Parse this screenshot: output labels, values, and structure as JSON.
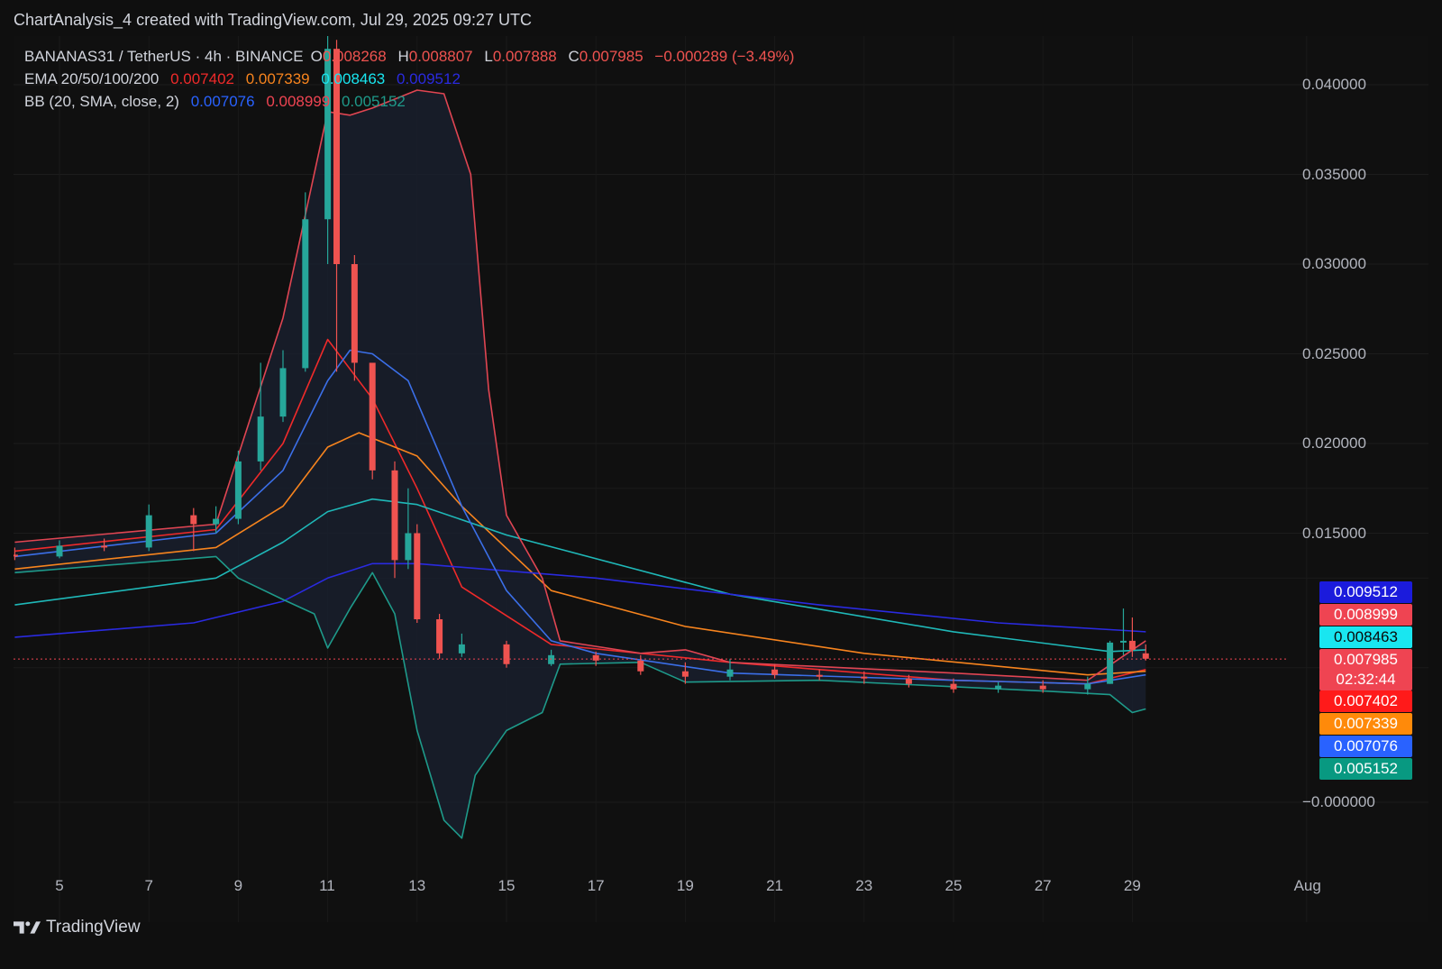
{
  "caption": "ChartAnalysis_4 created with TradingView.com, Jul 29, 2025 09:27 UTC",
  "legend": {
    "symbol": "BANANAS31 / TetherUS · 4h · BINANCE",
    "o_label": "O",
    "o_value": "0.008268",
    "h_label": "H",
    "h_value": "0.008807",
    "l_label": "L",
    "l_value": "0.007888",
    "c_label": "C",
    "c_value": "0.007985",
    "change": "−0.000289 (−3.49%)",
    "ema_label": "EMA 20/50/100/200",
    "ema_values": [
      "0.007402",
      "0.007339",
      "0.008463",
      "0.009512"
    ],
    "bb_label": "BB (20, SMA, close, 2)",
    "bb_values": [
      "0.007076",
      "0.008999",
      "0.005152"
    ]
  },
  "price_tags": [
    {
      "text": "0.009512",
      "color": "#1b1bdc",
      "value": 0.009512
    },
    {
      "text": "0.008999",
      "color": "#ef4452",
      "value": 0.008999
    },
    {
      "text": "0.008463",
      "color": "#19e6f0",
      "value": 0.008463
    },
    {
      "text": "0.007985",
      "color": "#ef4452",
      "value": 0.007985
    },
    {
      "text": "02:32:44",
      "color": "#ef4452",
      "value": null
    },
    {
      "text": "0.007402",
      "color": "#ff1a1a",
      "value": 0.007402
    },
    {
      "text": "0.007339",
      "color": "#ff8a0a",
      "value": 0.007339
    },
    {
      "text": "0.007076",
      "color": "#2962ff",
      "value": 0.007076
    },
    {
      "text": "0.005152",
      "color": "#089981",
      "value": 0.005152
    }
  ],
  "footer": "TradingView",
  "colors": {
    "up": "#26a69a",
    "down": "#ef5350",
    "ema20": "#ef2a2a",
    "ema50": "#f7841e",
    "ema100": "#1fb8b8",
    "ema200": "#2a2ae0",
    "bb_basis": "#3b6fe8",
    "bb_upper": "#e04552",
    "bb_lower": "#1e9a8a",
    "bb_fill": "#1a2030"
  },
  "chart_data": {
    "type": "candlestick",
    "title": "BANANAS31 / TetherUS · 4h · BINANCE",
    "x_ticks": [
      "5",
      "7",
      "9",
      "11",
      "13",
      "15",
      "17",
      "19",
      "21",
      "23",
      "25",
      "27",
      "29",
      "Aug"
    ],
    "y_ticks": [
      "0.040000",
      "0.035000",
      "0.030000",
      "0.025000",
      "0.020000",
      "0.015000",
      "−0.000000"
    ],
    "ylim": [
      -0.0035,
      0.0425
    ],
    "xlim": [
      "2025-07-04",
      "2025-08-03"
    ],
    "current_price": 0.007985,
    "countdown": "02:32:44",
    "candles_ohlc": [
      [
        "2025-07-04",
        0.0138,
        0.0142,
        0.0135,
        0.0137
      ],
      [
        "2025-07-05",
        0.0137,
        0.0146,
        0.0136,
        0.0143
      ],
      [
        "2025-07-06",
        0.0143,
        0.0147,
        0.014,
        0.0142
      ],
      [
        "2025-07-07",
        0.0142,
        0.0166,
        0.014,
        0.016
      ],
      [
        "2025-07-08",
        0.016,
        0.0164,
        0.014,
        0.0155
      ],
      [
        "2025-07-08.5",
        0.0155,
        0.0165,
        0.015,
        0.0158
      ],
      [
        "2025-07-09",
        0.0158,
        0.0196,
        0.0155,
        0.019
      ],
      [
        "2025-07-09.5",
        0.019,
        0.0245,
        0.0185,
        0.0215
      ],
      [
        "2025-07-10",
        0.0215,
        0.0252,
        0.0212,
        0.0242
      ],
      [
        "2025-07-10.5",
        0.0242,
        0.034,
        0.024,
        0.0325
      ],
      [
        "2025-07-11",
        0.0325,
        0.043,
        0.03,
        0.042
      ],
      [
        "2025-07-11.2",
        0.042,
        0.0425,
        0.024,
        0.03
      ],
      [
        "2025-07-11.6",
        0.03,
        0.0305,
        0.0235,
        0.0245
      ],
      [
        "2025-07-12",
        0.0245,
        0.022,
        0.018,
        0.0185
      ],
      [
        "2025-07-12.5",
        0.0185,
        0.019,
        0.0125,
        0.0135
      ],
      [
        "2025-07-12.8",
        0.0135,
        0.0175,
        0.013,
        0.015
      ],
      [
        "2025-07-13",
        0.015,
        0.0155,
        0.01,
        0.0102
      ],
      [
        "2025-07-13.5",
        0.0102,
        0.0105,
        0.008,
        0.0083
      ],
      [
        "2025-07-14",
        0.0083,
        0.0094,
        0.0081,
        0.0088
      ],
      [
        "2025-07-15",
        0.0088,
        0.009,
        0.0075,
        0.0077
      ],
      [
        "2025-07-16",
        0.0077,
        0.0085,
        0.0076,
        0.0082
      ],
      [
        "2025-07-17",
        0.0082,
        0.0084,
        0.0076,
        0.0079
      ],
      [
        "2025-07-18",
        0.0079,
        0.0082,
        0.0071,
        0.0073
      ],
      [
        "2025-07-19",
        0.0073,
        0.0078,
        0.0066,
        0.007
      ],
      [
        "2025-07-20",
        0.007,
        0.008,
        0.0068,
        0.0074
      ],
      [
        "2025-07-21",
        0.0074,
        0.0077,
        0.0069,
        0.0071
      ],
      [
        "2025-07-22",
        0.0071,
        0.0074,
        0.0068,
        0.007
      ],
      [
        "2025-07-23",
        0.007,
        0.0073,
        0.0066,
        0.0069
      ],
      [
        "2025-07-24",
        0.0069,
        0.0071,
        0.0064,
        0.0066
      ],
      [
        "2025-07-25",
        0.0066,
        0.0069,
        0.0061,
        0.0063
      ],
      [
        "2025-07-26",
        0.0063,
        0.0067,
        0.0061,
        0.0065
      ],
      [
        "2025-07-27",
        0.0065,
        0.0068,
        0.0061,
        0.0063
      ],
      [
        "2025-07-28",
        0.0063,
        0.007,
        0.006,
        0.0066
      ],
      [
        "2025-07-28.5",
        0.0066,
        0.009,
        0.0066,
        0.0089
      ],
      [
        "2025-07-28.8",
        0.0089,
        0.0108,
        0.0082,
        0.009
      ],
      [
        "2025-07-29",
        0.009,
        0.0103,
        0.0081,
        0.0085
      ],
      [
        "2025-07-29.3",
        0.0083,
        0.0088,
        0.0079,
        0.008
      ]
    ],
    "series": [
      {
        "name": "EMA 20",
        "color": "#ef2a2a",
        "points": [
          [
            "2025-07-04",
            0.014
          ],
          [
            "2025-07-08.5",
            0.0152
          ],
          [
            "2025-07-10",
            0.02
          ],
          [
            "2025-07-11",
            0.0258
          ],
          [
            "2025-07-12",
            0.0225
          ],
          [
            "2025-07-13",
            0.0175
          ],
          [
            "2025-07-14",
            0.012
          ],
          [
            "2025-07-16",
            0.0088
          ],
          [
            "2025-07-20",
            0.0078
          ],
          [
            "2025-07-25",
            0.0068
          ],
          [
            "2025-07-28",
            0.0066
          ],
          [
            "2025-07-29.3",
            0.0074
          ]
        ]
      },
      {
        "name": "EMA 50",
        "color": "#f7841e",
        "points": [
          [
            "2025-07-04",
            0.013
          ],
          [
            "2025-07-08.5",
            0.0142
          ],
          [
            "2025-07-10",
            0.0165
          ],
          [
            "2025-07-11",
            0.0198
          ],
          [
            "2025-07-11.7",
            0.0206
          ],
          [
            "2025-07-13",
            0.0193
          ],
          [
            "2025-07-14",
            0.0165
          ],
          [
            "2025-07-16",
            0.0118
          ],
          [
            "2025-07-19",
            0.0098
          ],
          [
            "2025-07-23",
            0.0083
          ],
          [
            "2025-07-28",
            0.0071
          ],
          [
            "2025-07-29.3",
            0.0073
          ]
        ]
      },
      {
        "name": "EMA 100",
        "color": "#1fb8b8",
        "points": [
          [
            "2025-07-04",
            0.011
          ],
          [
            "2025-07-08.5",
            0.0125
          ],
          [
            "2025-07-10",
            0.0145
          ],
          [
            "2025-07-11",
            0.0162
          ],
          [
            "2025-07-12",
            0.0169
          ],
          [
            "2025-07-13",
            0.0166
          ],
          [
            "2025-07-15",
            0.0149
          ],
          [
            "2025-07-20",
            0.0116
          ],
          [
            "2025-07-25",
            0.0095
          ],
          [
            "2025-07-28.5",
            0.0084
          ],
          [
            "2025-07-29.3",
            0.0085
          ]
        ]
      },
      {
        "name": "EMA 200",
        "color": "#2a2ae0",
        "points": [
          [
            "2025-07-04",
            0.0092
          ],
          [
            "2025-07-08",
            0.01
          ],
          [
            "2025-07-10",
            0.0112
          ],
          [
            "2025-07-11",
            0.0125
          ],
          [
            "2025-07-12",
            0.0133
          ],
          [
            "2025-07-13",
            0.0133
          ],
          [
            "2025-07-17",
            0.0125
          ],
          [
            "2025-07-22",
            0.011
          ],
          [
            "2025-07-26",
            0.01
          ],
          [
            "2025-07-29.3",
            0.0095
          ]
        ]
      },
      {
        "name": "BB basis",
        "color": "#3b6fe8",
        "points": [
          [
            "2025-07-04",
            0.0137
          ],
          [
            "2025-07-08.5",
            0.015
          ],
          [
            "2025-07-10",
            0.0185
          ],
          [
            "2025-07-11",
            0.0235
          ],
          [
            "2025-07-11.5",
            0.0252
          ],
          [
            "2025-07-12",
            0.025
          ],
          [
            "2025-07-12.8",
            0.0235
          ],
          [
            "2025-07-14",
            0.0165
          ],
          [
            "2025-07-15",
            0.0118
          ],
          [
            "2025-07-16",
            0.009
          ],
          [
            "2025-07-17",
            0.0083
          ],
          [
            "2025-07-20",
            0.0072
          ],
          [
            "2025-07-25",
            0.0068
          ],
          [
            "2025-07-28",
            0.0066
          ],
          [
            "2025-07-29.3",
            0.0071
          ]
        ]
      },
      {
        "name": "BB upper",
        "color": "#e04552",
        "points": [
          [
            "2025-07-04",
            0.0145
          ],
          [
            "2025-07-08.5",
            0.0155
          ],
          [
            "2025-07-10",
            0.027
          ],
          [
            "2025-07-11",
            0.0385
          ],
          [
            "2025-07-11.5",
            0.0383
          ],
          [
            "2025-07-12",
            0.0387
          ],
          [
            "2025-07-13",
            0.0397
          ],
          [
            "2025-07-13.6",
            0.0395
          ],
          [
            "2025-07-14.2",
            0.035
          ],
          [
            "2025-07-14.6",
            0.023
          ],
          [
            "2025-07-15",
            0.016
          ],
          [
            "2025-07-15.8",
            0.0125
          ],
          [
            "2025-07-16.2",
            0.009
          ],
          [
            "2025-07-18",
            0.0083
          ],
          [
            "2025-07-19",
            0.0085
          ],
          [
            "2025-07-20",
            0.0078
          ],
          [
            "2025-07-25",
            0.0072
          ],
          [
            "2025-07-28",
            0.0068
          ],
          [
            "2025-07-29.3",
            0.009
          ]
        ]
      },
      {
        "name": "BB lower",
        "color": "#1e9a8a",
        "points": [
          [
            "2025-07-04",
            0.0128
          ],
          [
            "2025-07-08.5",
            0.0137
          ],
          [
            "2025-07-09",
            0.0125
          ],
          [
            "2025-07-10",
            0.0113
          ],
          [
            "2025-07-10.7",
            0.0105
          ],
          [
            "2025-07-11",
            0.0086
          ],
          [
            "2025-07-11.5",
            0.0108
          ],
          [
            "2025-07-12",
            0.0128
          ],
          [
            "2025-07-12.5",
            0.0105
          ],
          [
            "2025-07-13",
            0.004
          ],
          [
            "2025-07-13.6",
            -0.001
          ],
          [
            "2025-07-14",
            -0.002
          ],
          [
            "2025-07-14.3",
            0.0015
          ],
          [
            "2025-07-15",
            0.004
          ],
          [
            "2025-07-15.8",
            0.005
          ],
          [
            "2025-07-16.2",
            0.0077
          ],
          [
            "2025-07-18",
            0.0078
          ],
          [
            "2025-07-19",
            0.0067
          ],
          [
            "2025-07-22",
            0.0068
          ],
          [
            "2025-07-27",
            0.0062
          ],
          [
            "2025-07-28.5",
            0.006
          ],
          [
            "2025-07-29",
            0.005
          ],
          [
            "2025-07-29.3",
            0.0052
          ]
        ]
      }
    ]
  }
}
